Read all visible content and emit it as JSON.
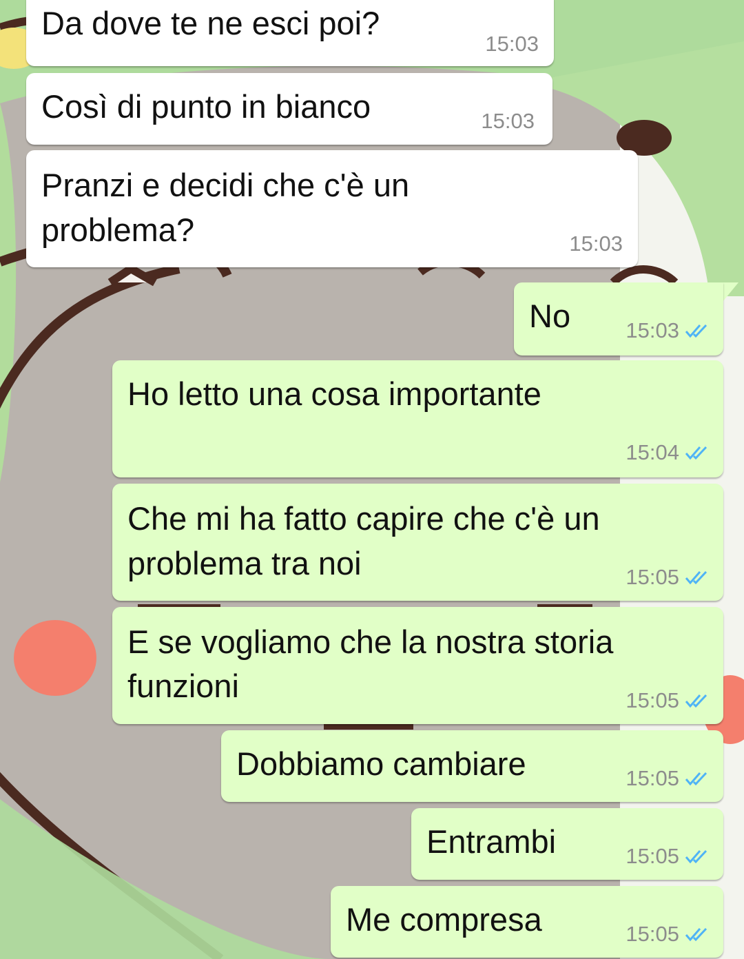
{
  "colors": {
    "incoming_bubble": "#ffffff",
    "outgoing_bubble": "#e1ffc7",
    "read_ticks": "#4fb3f6",
    "timestamp": "#8c8c8c"
  },
  "messages": [
    {
      "direction": "incoming",
      "lines": [
        "Da dove te ne esci poi?"
      ],
      "time": "15:03"
    },
    {
      "direction": "incoming",
      "lines": [
        "Così di punto in bianco"
      ],
      "time": "15:03"
    },
    {
      "direction": "incoming",
      "lines": [
        "Pranzi e decidi che c'è un",
        "problema?"
      ],
      "time": "15:03"
    },
    {
      "direction": "outgoing",
      "lines": [
        "No"
      ],
      "time": "15:03",
      "status_icon": "double-check-read-icon"
    },
    {
      "direction": "outgoing",
      "lines": [
        "Ho letto una cosa importante"
      ],
      "time": "15:04",
      "status_icon": "double-check-read-icon"
    },
    {
      "direction": "outgoing",
      "lines": [
        "Che mi ha fatto capire che c'è un",
        "problema tra noi"
      ],
      "time": "15:05",
      "status_icon": "double-check-read-icon"
    },
    {
      "direction": "outgoing",
      "lines": [
        "E se vogliamo che la nostra storia",
        "funzioni"
      ],
      "time": "15:05",
      "status_icon": "double-check-read-icon"
    },
    {
      "direction": "outgoing",
      "lines": [
        "Dobbiamo cambiare"
      ],
      "time": "15:05",
      "status_icon": "double-check-read-icon"
    },
    {
      "direction": "outgoing",
      "lines": [
        "Entrambi"
      ],
      "time": "15:05",
      "status_icon": "double-check-read-icon"
    },
    {
      "direction": "outgoing",
      "lines": [
        "Me compresa"
      ],
      "time": "15:05",
      "status_icon": "double-check-read-icon"
    }
  ]
}
